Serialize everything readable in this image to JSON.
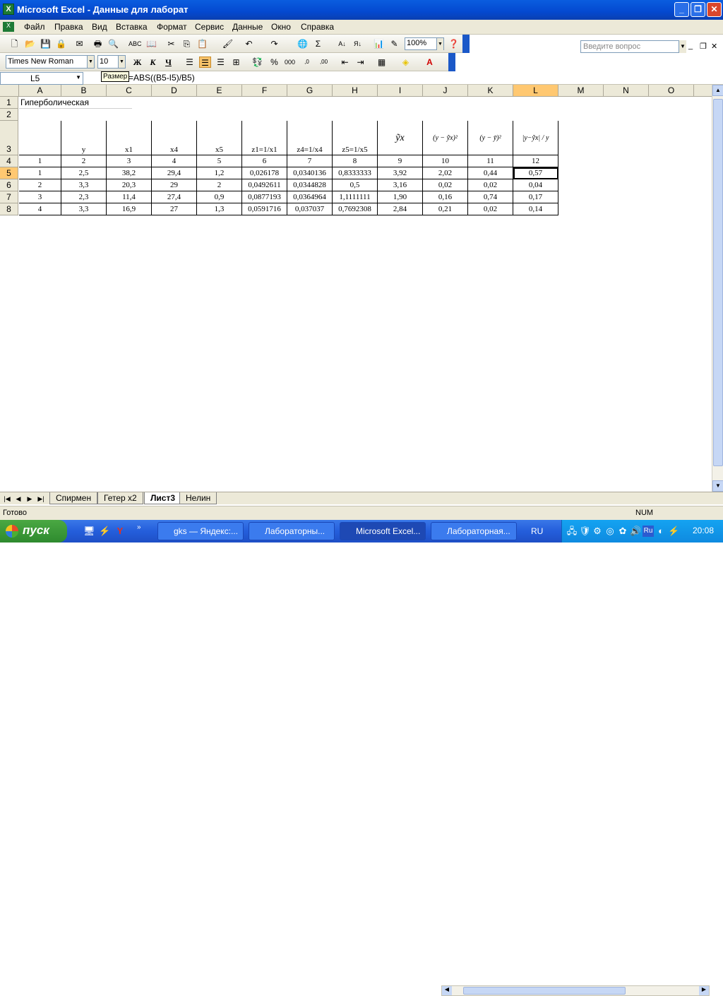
{
  "window": {
    "title": "Microsoft Excel - Данные для лаборат",
    "app_icon": "excel-icon"
  },
  "menu": {
    "items": [
      "Файл",
      "Правка",
      "Вид",
      "Вставка",
      "Формат",
      "Сервис",
      "Данные",
      "Окно",
      "Справка"
    ],
    "ask_placeholder": "Введите вопрос"
  },
  "toolbar": {
    "zoom": "100%",
    "font_name": "Times New Roman",
    "font_size": "10",
    "tooltip": "Размер"
  },
  "formula_bar": {
    "cell": "L5",
    "formula": "=ABS((B5-I5)/B5)"
  },
  "columns": [
    "A",
    "B",
    "C",
    "D",
    "E",
    "F",
    "G",
    "H",
    "I",
    "J",
    "K",
    "L",
    "M",
    "N",
    "O"
  ],
  "selected_column": "L",
  "selected_row": "5",
  "sheet": {
    "title_cell": "Гиперболическая",
    "headers_row3": [
      "",
      "y",
      "x1",
      "x4",
      "x5",
      "z1=1/x1",
      "z4=1/x4",
      "z5=1/x5",
      "ỹx",
      "(y − ỹx)²",
      "(y − ȳ)²",
      "|y−ỹx| / y"
    ],
    "numbers_row4": [
      "1",
      "2",
      "3",
      "4",
      "5",
      "6",
      "7",
      "8",
      "9",
      "10",
      "11",
      "12"
    ],
    "rows": [
      {
        "n": "5",
        "v": [
          "1",
          "2,5",
          "38,2",
          "29,4",
          "1,2",
          "0,026178",
          "0,0340136",
          "0,8333333",
          "3,92",
          "2,02",
          "0,44",
          "0,57"
        ]
      },
      {
        "n": "6",
        "v": [
          "2",
          "3,3",
          "20,3",
          "29",
          "2",
          "0,0492611",
          "0,0344828",
          "0,5",
          "3,16",
          "0,02",
          "0,02",
          "0,04"
        ]
      },
      {
        "n": "7",
        "v": [
          "3",
          "2,3",
          "11,4",
          "27,4",
          "0,9",
          "0,0877193",
          "0,0364964",
          "1,1111111",
          "1,90",
          "0,16",
          "0,74",
          "0,17"
        ]
      },
      {
        "n": "8",
        "v": [
          "4",
          "3,3",
          "16,9",
          "27",
          "1,3",
          "0,0591716",
          "0,037037",
          "0,7692308",
          "2,84",
          "0,21",
          "0,02",
          "0,14"
        ]
      }
    ]
  },
  "sheet_tabs": [
    "Спирмен",
    "Гетер x2",
    "Лист3",
    "Нелин"
  ],
  "active_tab": "Лист3",
  "status": {
    "left": "Готово",
    "num": "NUM"
  },
  "taskbar": {
    "start": "пуск",
    "items": [
      "gks — Яндекс:...",
      "Лабораторны...",
      "Microsoft Excel...",
      "Лабораторная..."
    ],
    "lang": "RU",
    "clock": "20:08"
  }
}
